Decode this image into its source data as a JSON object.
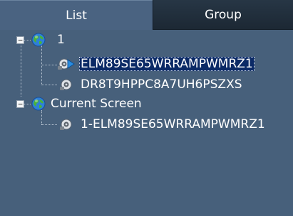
{
  "tabs": [
    {
      "label": "List",
      "active": true
    },
    {
      "label": "Group",
      "active": false
    }
  ],
  "tree": {
    "groups": [
      {
        "label": "1",
        "expanded": true,
        "toggle": "−",
        "icon": "globe-icon",
        "items": [
          {
            "label": "ELM89SE65WRRAMPWMRZ1",
            "selected": true,
            "icon": "device-play-icon"
          },
          {
            "label": "DR8T9HPPC8A7UH6PSZXS",
            "selected": false,
            "icon": "device-icon"
          }
        ]
      },
      {
        "label": "Current Screen",
        "expanded": true,
        "toggle": "−",
        "icon": "globe-icon",
        "items": [
          {
            "label": "1-ELM89SE65WRRAMPWMRZ1",
            "selected": false,
            "icon": "device-icon"
          }
        ]
      }
    ]
  },
  "colors": {
    "panel_bg": "#47607b",
    "active_tab_bg": "#4a6381",
    "inactive_tab_bg": "#22303e",
    "selection_bg": "#0b2a66",
    "text": "#ffffff"
  }
}
